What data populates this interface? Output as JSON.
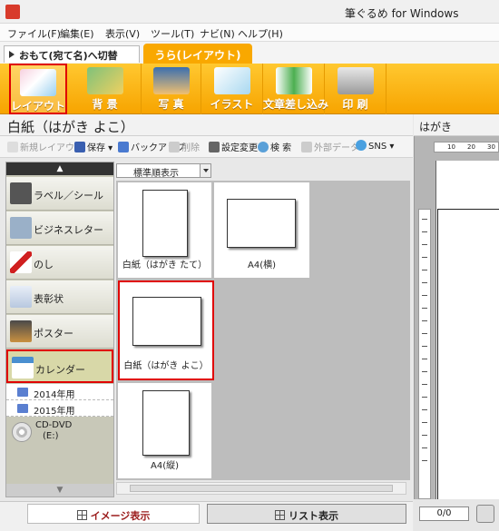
{
  "window": {
    "title": "筆ぐるめ for Windows"
  },
  "menu": [
    "ファイル(F)",
    "編集(E)",
    "表示(V)",
    "ツール(T)",
    "ナビ(N)",
    "ヘルプ(H)"
  ],
  "mode_tabs": {
    "front_switch": "おもて(宛て名)へ切替",
    "back": "うら(レイアウト)"
  },
  "ribbon": [
    {
      "label": "レイアウト",
      "icon": "layout-icon",
      "selected": true
    },
    {
      "label": "背 景",
      "icon": "background-icon"
    },
    {
      "label": "写 真",
      "icon": "photo-icon"
    },
    {
      "label": "イラスト",
      "icon": "illustration-icon"
    },
    {
      "label": "文章差し込み",
      "icon": "text-insert-icon"
    },
    {
      "label": "印 刷",
      "icon": "printer-icon"
    }
  ],
  "document": {
    "title": "白紙（はがき よこ）"
  },
  "toolbar": {
    "new_layout": "新規レイアウト",
    "save": "保存",
    "backup": "バックアップ",
    "delete": "削除",
    "settings": "設定変更",
    "search": "検 索",
    "external_data": "外部データ",
    "sns": "SNS"
  },
  "sort": {
    "selected": "標準順表示"
  },
  "categories": [
    {
      "label": "ラベル／シール",
      "icon": "label-icon"
    },
    {
      "label": "ビジネスレター",
      "icon": "business-letter-icon"
    },
    {
      "label": "のし",
      "icon": "noshi-icon"
    },
    {
      "label": "表彰状",
      "icon": "certificate-icon"
    },
    {
      "label": "ポスター",
      "icon": "poster-icon"
    },
    {
      "label": "カレンダー",
      "icon": "calendar-icon",
      "selected": true
    }
  ],
  "subfolders": [
    "2014年用",
    "2015年用"
  ],
  "drive": {
    "line1": "CD-DVD",
    "line2": "(E:)"
  },
  "templates": [
    {
      "label": "白紙（はがき たて）"
    },
    {
      "label": "A4(横)"
    },
    {
      "label": "白紙（はがき よこ）",
      "selected": true
    },
    {
      "label": "A4(縦)"
    }
  ],
  "view_tabs": {
    "image": "イメージ表示",
    "list": "リスト表示"
  },
  "preview": {
    "title": "はがき",
    "ruler_labels": [
      "10",
      "20",
      "30"
    ],
    "page_counter": "0/0"
  },
  "colors": {
    "ribbon": "#f7a400",
    "highlight": "#e00000",
    "tab_active": "#f9a800"
  }
}
